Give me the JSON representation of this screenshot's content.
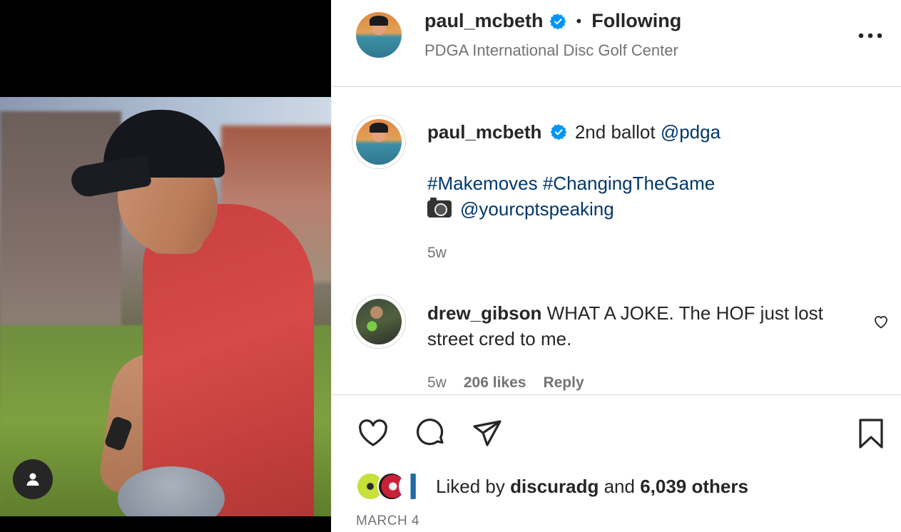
{
  "post": {
    "author": {
      "username": "paul_mcbeth",
      "verified": true,
      "follow_status": "Following",
      "separator": "•",
      "location": "PDGA International Disc Golf Center"
    },
    "caption": {
      "username": "paul_mcbeth",
      "text": "2nd ballot ",
      "mention": "@pdga",
      "hashtags": "#Makemoves #ChangingTheGame",
      "photo_credit": "@yourcptspeaking",
      "time": "5w"
    },
    "comments": [
      {
        "username": "drew_gibson",
        "text": "WHAT A JOKE. The HOF just lost street cred to me.",
        "time": "5w",
        "likes": "206 likes",
        "reply_label": "Reply"
      }
    ],
    "likes": {
      "prefix": "Liked by",
      "top_liker": "discuradg",
      "connector": "and",
      "others": "6,039 others"
    },
    "date": "MARCH 4"
  },
  "icons": {
    "more": "more-horizontal-icon",
    "like": "heart-icon",
    "comment": "comment-bubble-icon",
    "share": "paper-plane-icon",
    "save": "bookmark-icon",
    "tags": "user-tag-icon",
    "verified": "verified-badge-icon"
  },
  "colors": {
    "text": "#262626",
    "secondary": "#737373",
    "link": "#00376b",
    "verified": "#0095f6",
    "divider": "#dbdbdb"
  }
}
